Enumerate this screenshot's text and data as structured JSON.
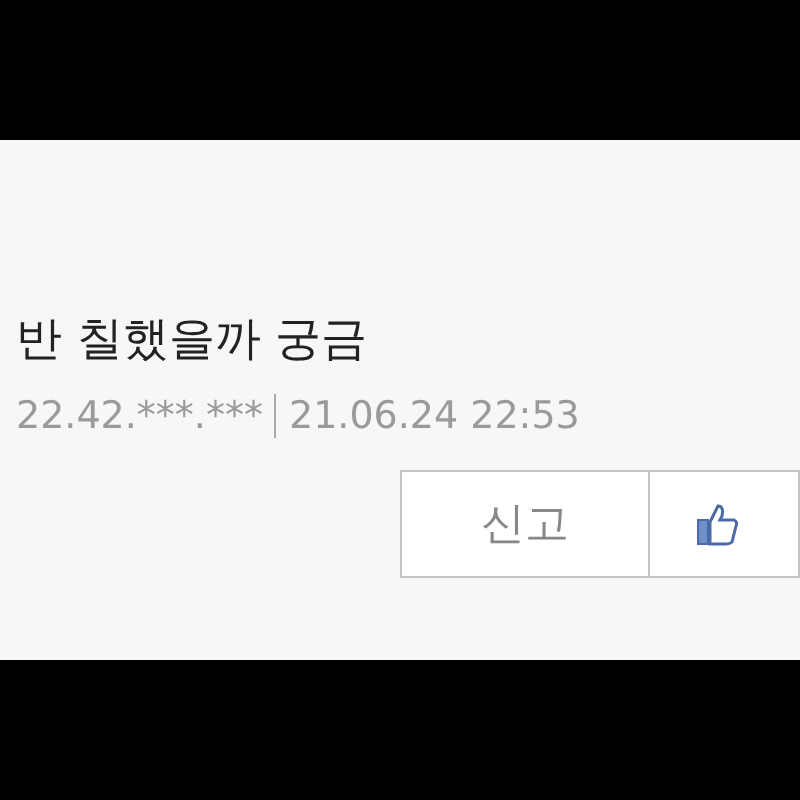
{
  "comment": {
    "text": "반 칠했을까 궁금",
    "ip": "22.42.***.***",
    "date": "21.06.24 22:53"
  },
  "actions": [
    {
      "kind": "report",
      "label": "신고"
    },
    {
      "kind": "like"
    }
  ]
}
